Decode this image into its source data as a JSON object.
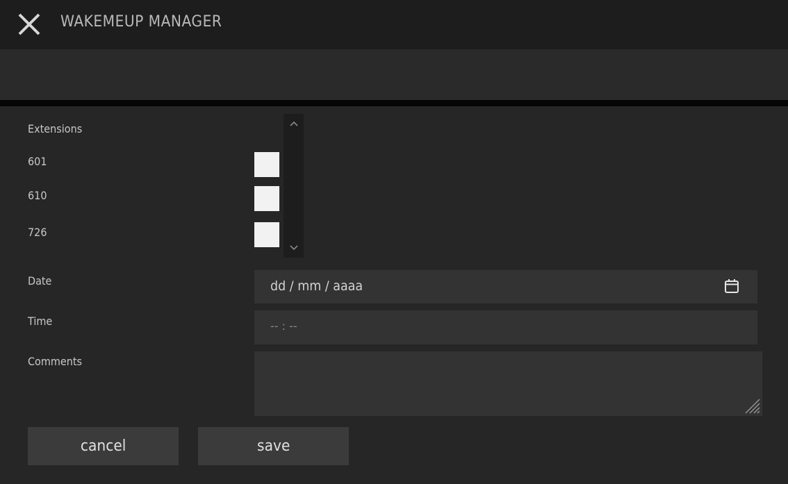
{
  "window": {
    "title": "WAKEMEUP MANAGER",
    "close_icon": "close-icon"
  },
  "form": {
    "extensions_label": "Extensions",
    "extensions": [
      {
        "number": "601",
        "checked": false
      },
      {
        "number": "610",
        "checked": false
      },
      {
        "number": "726",
        "checked": false
      }
    ],
    "date": {
      "label": "Date",
      "placeholder": "dd / mm / aaaa",
      "icon": "calendar-icon"
    },
    "time": {
      "label": "Time",
      "placeholder": "-- : --"
    },
    "comments": {
      "label": "Comments",
      "value": ""
    }
  },
  "buttons": {
    "cancel_label": "cancel",
    "save_label": "save"
  },
  "colors": {
    "background": "#262626",
    "titlebar": "#1d1d1d",
    "field": "#333333",
    "button": "#3b3b3b",
    "checkbox": "#f2f2f2"
  }
}
